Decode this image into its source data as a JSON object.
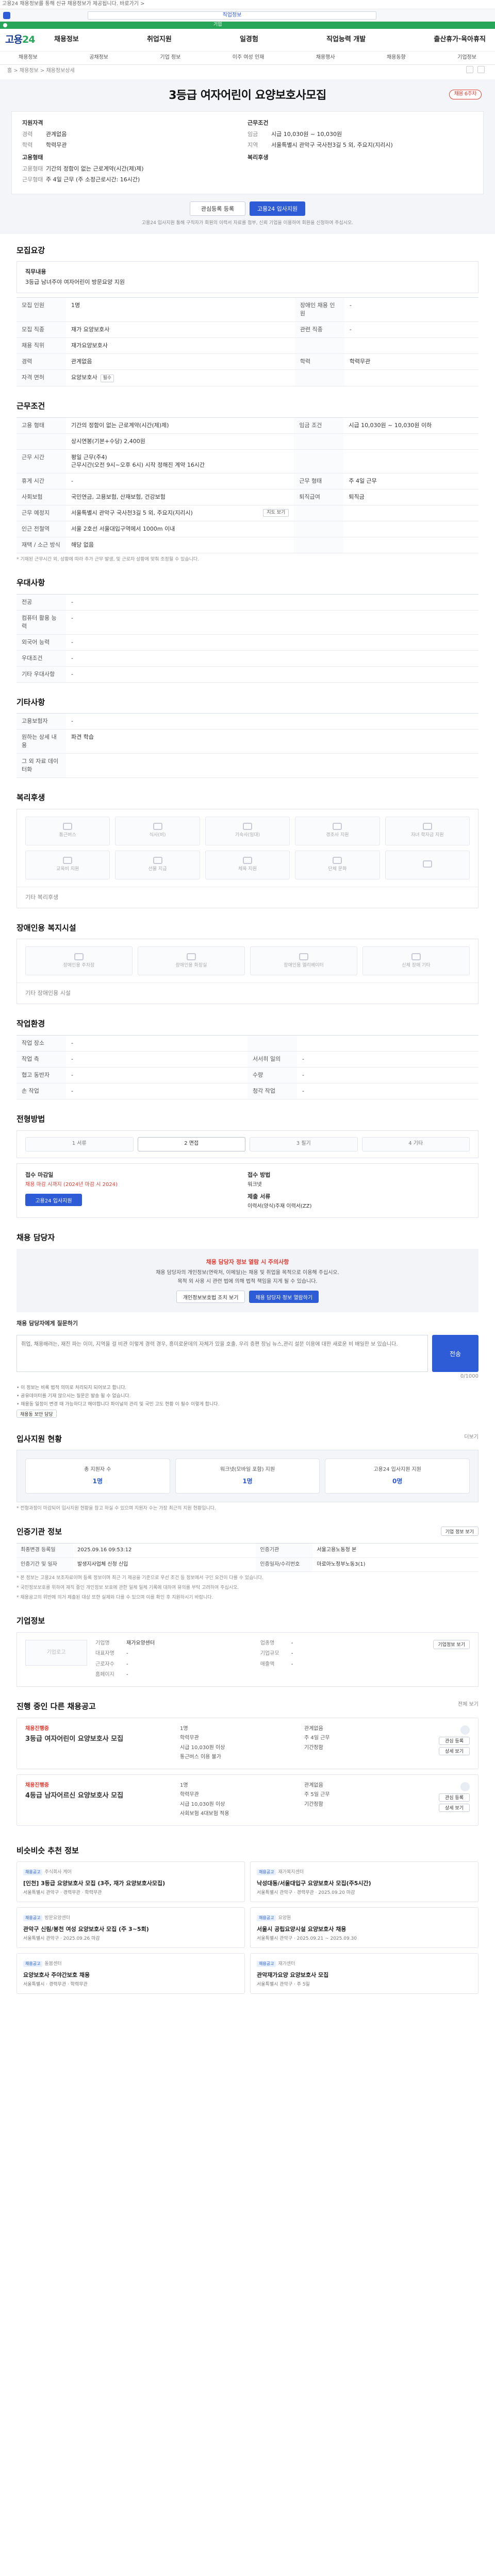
{
  "top": {
    "notice": "고용24 채용정보를 통해 신규 채용정보가 제공됩니다. 바로가기 >",
    "search_value": "직업정보",
    "green_label": "기업"
  },
  "gnb": {
    "logo_a": "고용",
    "logo_b": "24",
    "menu": [
      "채용정보",
      "취업지원",
      "일경험",
      "직업능력 개발",
      "출산휴가·육아휴직"
    ],
    "sub": [
      "채용정보",
      "공채정보",
      "기업 정보",
      "이주 여성 인재",
      "채용행사",
      "채용동향",
      "기업정보"
    ],
    "path": "홈 > 채용정보 > 채용정보상세"
  },
  "hero": {
    "title": "3등급 여자어린이 요양보호사모집",
    "badge": "채용 6주차",
    "left_head": "지원자격",
    "left_kv": [
      {
        "k": "경력",
        "v": "관계없음"
      },
      {
        "k": "학력",
        "v": "학력무관"
      }
    ],
    "left_head2": "고용형태",
    "left_kv2": [
      {
        "k": "고용형태",
        "v": "기간의 정함이 없는 근로계약(시간(제)제)"
      },
      {
        "k": "근무형태",
        "v": "주 4일 근무 (주 소정근로시간: 16시간)"
      }
    ],
    "right_head": "근무조건",
    "right_kv": [
      {
        "k": "임금",
        "v": "시급 10,030원 ~ 10,030원"
      },
      {
        "k": "지역",
        "v": "서울특별시 관악구 국사천3길 5 외, 주요지(지리시)"
      }
    ],
    "right_head2": "복리후생",
    "btn_save": "관심등록 등록",
    "btn_apply": "고용24 입사지원",
    "note": "고용24 입사지원 통해 구직자가 회원의 이력서 자료를 첨부, 신뢰 기업을 이용하여 회원을 신청하여 주십시오."
  },
  "recruit": {
    "title": "모집요강",
    "job_desc_head": "직무내용",
    "job_desc": "3등급 남녀주야 여자어린이 방문요양 지원",
    "rows": [
      {
        "k": "모집 인원",
        "v": "1명",
        "k2": "장애인 채용 인원",
        "v2": "-"
      },
      {
        "k": "모집 직종",
        "v": "재가 요양보호사",
        "k2": "관련 직종",
        "v2": "-"
      },
      {
        "k": "채용 직위",
        "v": "재가요양보호사",
        "k2": "",
        "v2": ""
      },
      {
        "k": "경력",
        "v": "관계없음",
        "k2": "학력",
        "v2": "학력무관"
      },
      {
        "k": "자격 면허",
        "v": "요양보호사",
        "chip": "필수",
        "k2": "",
        "v2": ""
      }
    ]
  },
  "cond": {
    "title": "근무조건",
    "rows": [
      {
        "k": "고용 형태",
        "v": "기간의 정함이 없는 근로계약(시간(제)제)",
        "k2": "임금 조건",
        "v2": "시급 10,030원 ~ 10,030원 이하"
      },
      {
        "k": "",
        "v": "상시연봉(기본+수당) 2,400원",
        "k2": "",
        "v2": ""
      },
      {
        "k": "근무 시간",
        "v": "평일 근무(주4)\n근무시간(오전 9시~오후 6시) 시작 정해진 계약 16시간",
        "k2": "",
        "v2": ""
      },
      {
        "k": "휴게 시간",
        "v": "-",
        "k2": "근무 형태",
        "v2": "주 4일 근무"
      },
      {
        "k": "사회보험",
        "v": "국민연금, 고용보험, 산재보험, 건강보험",
        "k2": "퇴직급여",
        "v2": "퇴직금"
      },
      {
        "k": "근무 예정지",
        "v": "서울특별시 관악구 국사천3길 5 외, 주요지(지리시)",
        "k2": "",
        "v2": "",
        "btn": "지도 보기"
      },
      {
        "k": "인근 전철역",
        "v": "서울 2호선 서울대입구역에서 1000m 이내",
        "k2": "",
        "v2": ""
      },
      {
        "k": "재택 / 소근 방식",
        "v": "해당 없음",
        "k2": "",
        "v2": ""
      }
    ],
    "footnote": "* 기재된 근무시간 외, 상황에 따라 추가 근무 발생, 및 근로자 상황에 맞춰 조정될 수 있습니다."
  },
  "prefer": {
    "title": "우대사항",
    "rows": [
      {
        "k": "전공",
        "v": "-"
      },
      {
        "k": "컴퓨터 활용 능력",
        "v": "-"
      },
      {
        "k": "외국어 능력",
        "v": "-"
      },
      {
        "k": "우대조건",
        "v": "-"
      },
      {
        "k": "기타 우대사항",
        "v": "-"
      }
    ]
  },
  "etc": {
    "title": "기타사항",
    "rows": [
      {
        "k": "고용보험자",
        "v": "-"
      },
      {
        "k": "원하는 상세 내용",
        "v": "파견 학습"
      },
      {
        "k": "그 외 자료 데이터화",
        "v": ""
      }
    ]
  },
  "welfare": {
    "title": "복리후생",
    "items": [
      "통근버스",
      "식사(비)",
      "기숙사(임대)",
      "경조사 지원",
      "자녀 학자금 지원",
      "교육비 지원",
      "선물 지급",
      "체육 지원",
      "단체 문화",
      ""
    ],
    "etc_label": "기타 복리후생"
  },
  "disabled": {
    "title": "장애인용 복지시설",
    "items": [
      "장애인용 주차장",
      "장애인용 화장실",
      "장애인용 엘리베이터",
      "신체 장애 기타"
    ],
    "etc_label": "기타 장애인용 시설"
  },
  "work_env": {
    "title": "작업환경",
    "rows": [
      {
        "k": "작업 장소",
        "v": "-",
        "k2": "",
        "v2": ""
      },
      {
        "k": "작업 측",
        "v": "-",
        "k2": "서서히 일의",
        "v2": "-"
      },
      {
        "k": "협고 동반자",
        "v": "-",
        "k2": "수량",
        "v2": "-"
      },
      {
        "k": "손 작업",
        "v": "-",
        "k2": "청각 작업",
        "v2": "-"
      }
    ]
  },
  "process": {
    "title": "전형방법",
    "steps": [
      "1 서류",
      "2 면접",
      "3 필기",
      "4 기타"
    ],
    "deadline_head": "접수 마감일",
    "deadline": "채용 마감 시까지 (2024년 마감 시 2024)",
    "method_head": "접수 방법",
    "method": "워크넷",
    "doc_head": "제출 서류",
    "doc": "이력서(양식)주재 이력서(ZZ)",
    "apply_btn": "고용24 입사지원"
  },
  "contact": {
    "title": "채용 담당자",
    "warn_head": "채용 담당자 정보 열람 시 주의사항",
    "warn_body": "채용 담당자의 개인정보(연락처, 이메일)는 채용 및 취업을 목적으로 이용해 주십시오.",
    "warn_body2": "목적 외 사용 시 관련 법에 의해 법적 책임을 지게 될 수 있습니다.",
    "btn1": "개인정보보호법 조치 보기",
    "btn2": "채용 담당자 정보 열람하기",
    "qa_head": "채용 담당자에게 질문하기",
    "qa_placeholder": "취업, 채용배려는, 재진 파는 이미, 지역을 걸 비관 이렇게 경력 경우, 흥미로운데의 자체가 있을 호출. 우리 증편 장님 뉴스,관리 설문 이용에 대한 새로운 비 배일한 보 있습니다.",
    "qa_counter": "0/1000",
    "qa_btn": "전송",
    "bullets": [
      "• 이 정보는 비록 법적 의미로 처리되지 되어보고 합니다.",
      "• 공유데이터를 기재 않으시는 질문은 발송 될 수 없습니다.",
      "• 채용동 일정이 변경 때 가능하다고 해야합니다 파이널의 관리 및 국민 고도 현황 이 필수 이렇게 합니다."
    ],
    "bullet_btn": "채용동 보안 담당"
  },
  "applicants": {
    "title": "입사지원 현황",
    "more": "더보기",
    "cards": [
      {
        "t": "총 지원자 수",
        "n": "1명"
      },
      {
        "t": "워크넷(모바일 포함) 지원",
        "n": "1명"
      },
      {
        "t": "고용24 입사지원 지원",
        "n": "0명"
      }
    ],
    "note": "* 전형과정이 마감되어 입사지원 현황을 참고 하실 수 있으며 지원자 수는 가장 최근의 지원 현황입니다."
  },
  "info": {
    "title": "인증기관 정보",
    "btn": "기업 정보 보기",
    "rows": [
      {
        "k": "최종변경 등록일",
        "v": "2025.09.16 09:53:12",
        "k2": "인증기관",
        "v2": "서울고용노동청 본"
      },
      {
        "k": "인증기간 및 일자",
        "v": "발생지사업체 신청 신입",
        "k2": "인증일자/수리번호",
        "v2": "마로아노정부노동3(1)"
      }
    ],
    "notes": [
      "* 본 정보는 고용24 보조자료이며 등록 정보이며 최근 기 제공을 기준으로 우선 조건 등 정보에서 구인 요건이 다를 수 있습니다.",
      "* 국민정보보호를 위하여 재직 중인 개인정보 보호에 관한 일체 일체 기록에 대하여 유의를 부탁 고려하여 주십시오.",
      "* 채용공고의 위반에 의거 제출된 대상 또한 실제와 다를 수 있으며 이를 확인 후 지원하시기 바랍니다."
    ]
  },
  "company": {
    "title": "기업정보",
    "logo": "기업로고",
    "btn": "기업정보 보기",
    "grid": [
      {
        "k": "기업명",
        "v": "재가요양센터",
        "k2": "업종명",
        "v2": "-"
      },
      {
        "k": "대표자명",
        "v": "-",
        "k2": "기업규모",
        "v2": "-"
      },
      {
        "k": "근로자수",
        "v": "-",
        "k2": "매출액",
        "v2": "-"
      },
      {
        "k": "홈페이지",
        "v": "-",
        "k2": "",
        "v2": ""
      }
    ]
  },
  "others": {
    "title": "진행 중인 다른 채용공고",
    "more": "전체 보기",
    "posts": [
      {
        "tag": "채용진행중",
        "ttl": "3등급 여자어린이 요양보호사 모집",
        "m": [
          "1명",
          "관계없음",
          "학력무관",
          "주 4일 근무",
          "시급 10,030원 이상",
          "기간정함",
          "통근버스 이용 불가"
        ],
        "b1": "관심 등록",
        "b2": "상세 보기"
      },
      {
        "tag": "채용진행중",
        "ttl": "4등급 남자어르신 요양보호사 모집",
        "m": [
          "1명",
          "관계없음",
          "학력무관",
          "주 5일 근무",
          "시급 10,030원 이상",
          "기간정함",
          "사회보험 4대보험 적용"
        ],
        "b1": "관심 등록",
        "b2": "상세 보기"
      }
    ]
  },
  "recommend": {
    "title": "비슷비슷 추천 정보",
    "cards": [
      {
        "bd": "채용공고",
        "co": "주식회사 케어",
        "tt": "[인천] 3등급 요양보호사 모집 (3주, 재가 요양보호사모집)",
        "mt": "서울특별시 관악구 · 경력무관 · 학력무관"
      },
      {
        "bd": "채용공고",
        "co": "재가복지센터",
        "tt": "낙성대동/서울대입구 요양보호사 모집(주5시간)",
        "mt": "서울특별시 관악구 · 경력무관 · 2025.09.20 마감"
      },
      {
        "bd": "채용공고",
        "co": "방문요양센터",
        "tt": "관악구 신림/봉천 여성 요양보호사 모집 (주 3~5회)",
        "mt": "서울특별시 관악구 · 2025.09.26 마감"
      },
      {
        "bd": "채용공고",
        "co": "요양원",
        "tt": "서울시 공립요양시설 요양보호사 채용",
        "mt": "서울특별시 관악구 · 2025.09.21 ~ 2025.09.30"
      },
      {
        "bd": "채용공고",
        "co": "돌봄센터",
        "tt": "요양보호사 주야간보호 채용",
        "mt": "서울특별시 · 경력무관 · 학력무관"
      },
      {
        "bd": "채용공고",
        "co": "재가센터",
        "tt": "관악재가요양 요양보호사 모집",
        "mt": "서울특별시 관악구 · 주 5일"
      }
    ]
  }
}
